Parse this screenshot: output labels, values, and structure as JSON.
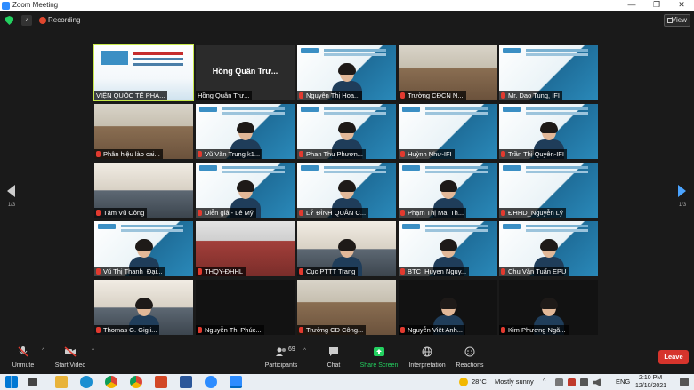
{
  "window": {
    "title": "Zoom Meeting",
    "minimize": "—",
    "restore": "❐",
    "close": "✕"
  },
  "topbar": {
    "recording_label": "Recording",
    "view_label": "View"
  },
  "nav": {
    "page_indicator_left": "1/3",
    "page_indicator_right": "1/3"
  },
  "tiles": [
    {
      "name": "VIỆN QUỐC TẾ PHÁ...",
      "scene": "slide",
      "muted": false,
      "active": true
    },
    {
      "name": "Hồng Quân Trư...",
      "scene": "dark",
      "muted": false,
      "big": true,
      "big_name": "Hồng Quân Trư..."
    },
    {
      "name": "Nguyễn Thị Hoa...",
      "scene": "webinar",
      "muted": true,
      "person": true
    },
    {
      "name": "Trường CĐCN N...",
      "scene": "room",
      "muted": true
    },
    {
      "name": "Mr. Dao Tung, IFI",
      "scene": "webinar",
      "muted": true
    },
    {
      "name": "Phân hiệu lào cai...",
      "scene": "room",
      "muted": true
    },
    {
      "name": "Vũ Văn Trung k1...",
      "scene": "webinar",
      "muted": true,
      "person": true
    },
    {
      "name": "Phan Thu Phươn...",
      "scene": "webinar",
      "muted": true,
      "person": true
    },
    {
      "name": "Huỳnh Như-IFI",
      "scene": "webinar",
      "muted": true
    },
    {
      "name": "Trần Thị Quyên-IFI",
      "scene": "webinar",
      "muted": true,
      "person": true
    },
    {
      "name": "Tâm Vũ Công",
      "scene": "office",
      "muted": true
    },
    {
      "name": "Diễn giả - Lê Mỹ",
      "scene": "webinar",
      "muted": true,
      "person": true
    },
    {
      "name": "LÝ ĐÌNH QUÂN C...",
      "scene": "webinar",
      "muted": true,
      "person": true
    },
    {
      "name": "Phạm Thị Mai Th...",
      "scene": "webinar",
      "muted": true,
      "person": true
    },
    {
      "name": "ĐHHD_Nguyễn Lý",
      "scene": "webinar",
      "muted": true
    },
    {
      "name": "Vũ Thị Thanh_Đại...",
      "scene": "webinar",
      "muted": true,
      "person": true
    },
    {
      "name": "THQY-ĐHHL",
      "scene": "hall",
      "muted": true
    },
    {
      "name": "Cục PTTT Trang",
      "scene": "office",
      "muted": true,
      "person": true
    },
    {
      "name": "BTC_Huyen Nguy...",
      "scene": "webinar",
      "muted": true,
      "person": true
    },
    {
      "name": "Chu Văn Tuấn EPU",
      "scene": "webinar",
      "muted": true,
      "person": true
    },
    {
      "name": "Thomas G. Gigli...",
      "scene": "office",
      "muted": true,
      "person": true
    },
    {
      "name": "Nguyễn Thị Phúc...",
      "scene": "black",
      "muted": true
    },
    {
      "name": "Trường CĐ Công...",
      "scene": "room",
      "muted": true
    },
    {
      "name": "Nguyễn Việt Anh...",
      "scene": "black",
      "muted": true,
      "person": true
    },
    {
      "name": "Kim Phương Ngã...",
      "scene": "black",
      "muted": true,
      "person": true
    }
  ],
  "controls": {
    "unmute": "Unmute",
    "start_video": "Start Video",
    "participants": "Participants",
    "participants_count": "69",
    "chat": "Chat",
    "share_screen": "Share Screen",
    "interpretation": "Interpretation",
    "reactions": "Reactions",
    "leave": "Leave"
  },
  "taskbar": {
    "weather_temp": "28°C",
    "weather_desc": "Mostly sunny",
    "lang": "ENG",
    "time": "2:10 PM",
    "date": "12/10/2021"
  },
  "colors": {
    "accent": "#2d8cff",
    "leave": "#d6342c",
    "share": "#23d160",
    "active_speaker": "#c7e84b",
    "muted": "#e23a2f"
  }
}
